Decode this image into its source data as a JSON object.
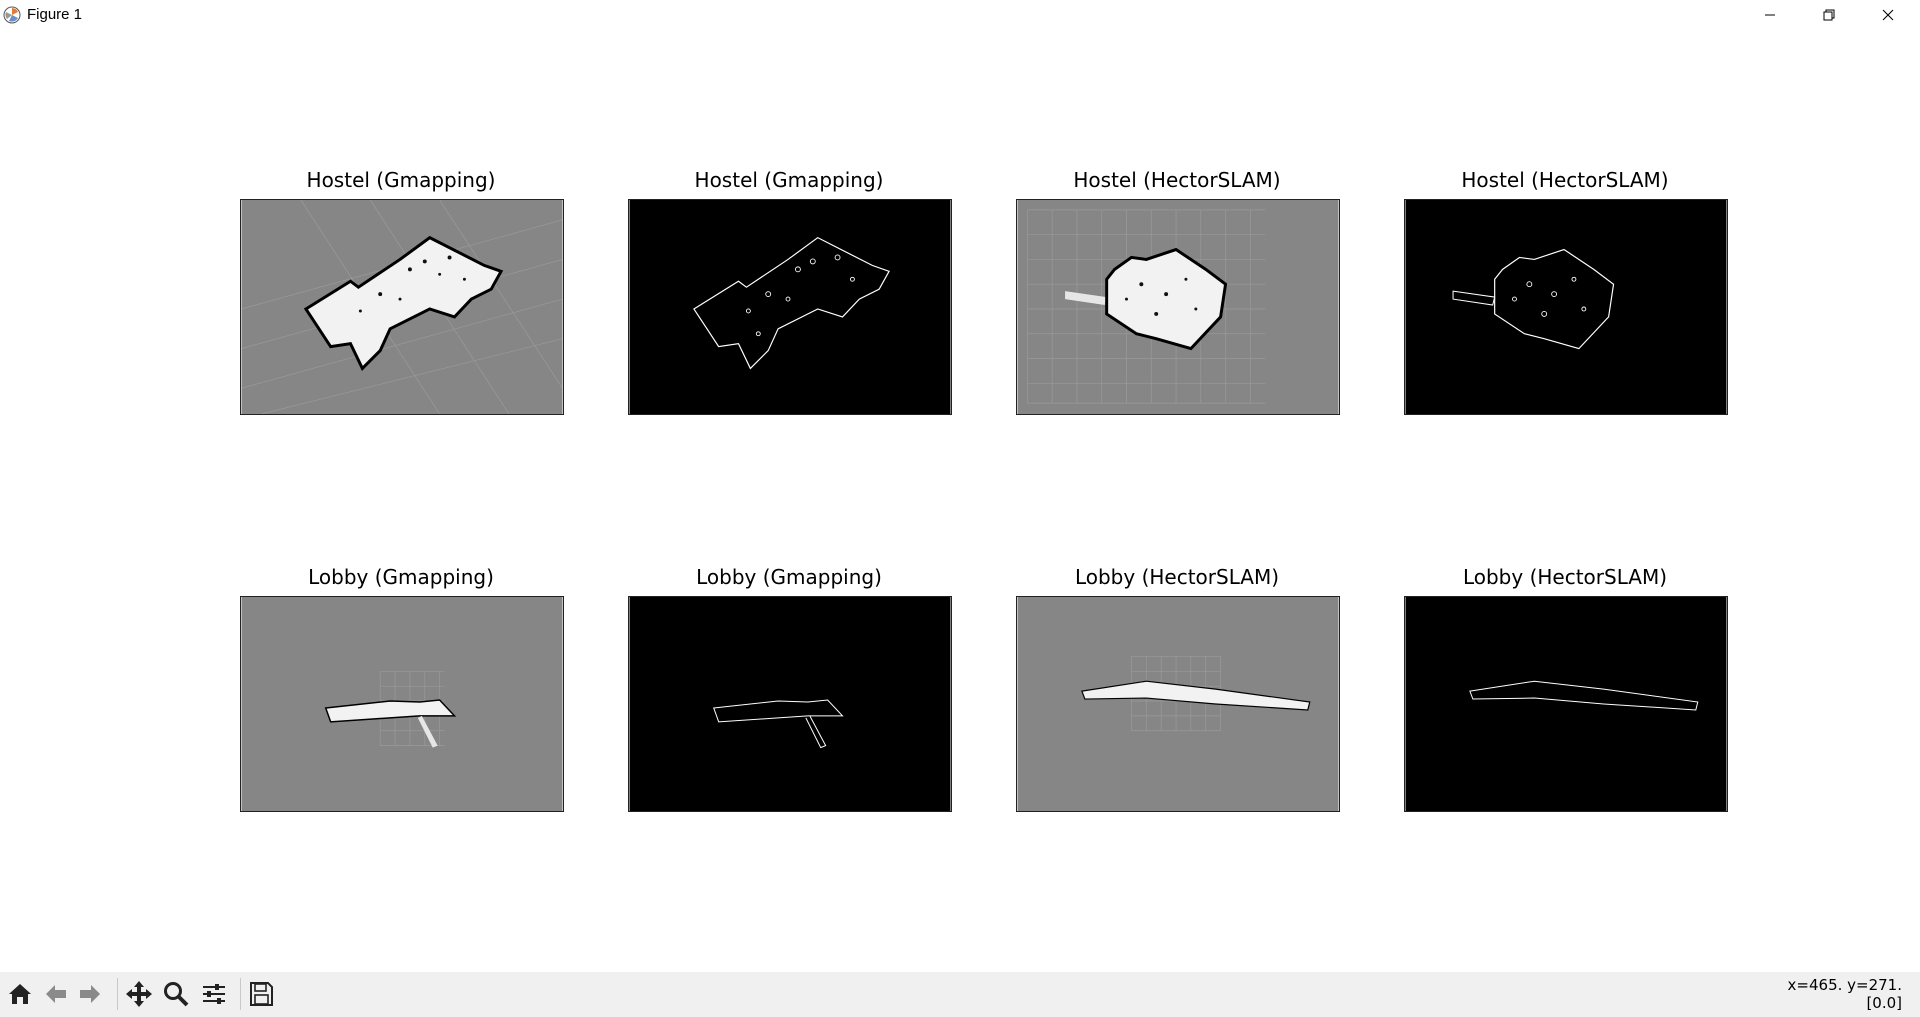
{
  "window": {
    "title": "Figure 1"
  },
  "panels": [
    {
      "title": "Hostel (Gmapping)"
    },
    {
      "title": "Hostel (Gmapping)"
    },
    {
      "title": "Hostel (HectorSLAM)"
    },
    {
      "title": "Hostel (HectorSLAM)"
    },
    {
      "title": "Lobby (Gmapping)"
    },
    {
      "title": "Lobby (Gmapping)"
    },
    {
      "title": "Lobby (HectorSLAM)"
    },
    {
      "title": "Lobby (HectorSLAM)"
    }
  ],
  "status": {
    "coords": "x=465. y=271.",
    "value": "[0.0]"
  },
  "toolbar": [
    "home-icon",
    "back-icon",
    "forward-icon",
    "pan-icon",
    "zoom-icon",
    "configure-icon",
    "save-icon"
  ],
  "colors": {
    "map_bg": "#868686",
    "edge_bg": "#000000",
    "free_space": "#f2f2f2",
    "toolbar_bg": "#f0f0f0"
  }
}
